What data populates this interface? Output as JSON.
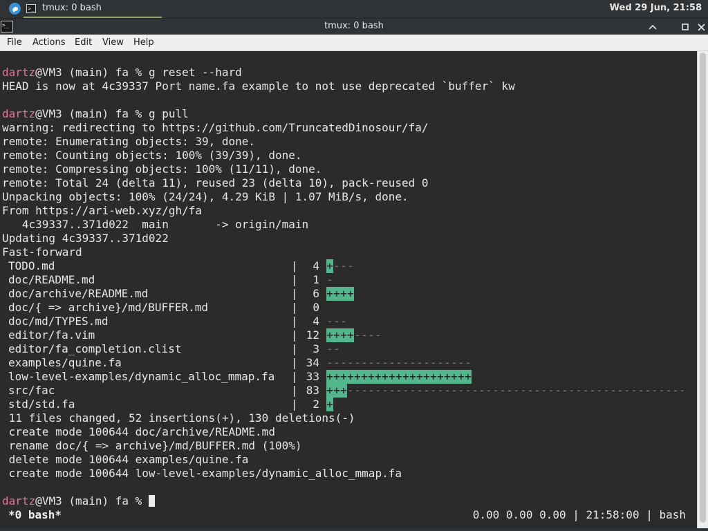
{
  "taskbar": {
    "logo_icon": "whisker-menu-icon",
    "task_label": "tmux: 0 bash",
    "clock": "Wed 29 Jun, 21:58"
  },
  "window": {
    "title": "tmux: 0 bash"
  },
  "menu": {
    "file": "File",
    "actions": "Actions",
    "edit": "Edit",
    "view": "View",
    "help": "Help"
  },
  "terminal": {
    "prompt_user": "dartz",
    "prompt_rest": "@VM3 (main) fa % ",
    "cmd1": "g reset --hard",
    "reset_out": "HEAD is now at 4c39337 Port name.fa example to not use deprecated `buffer` kw",
    "cmd2": "g pull",
    "pull_out": [
      "warning: redirecting to https://github.com/TruncatedDinosour/fa/",
      "remote: Enumerating objects: 39, done.",
      "remote: Counting objects: 100% (39/39), done.",
      "remote: Compressing objects: 100% (11/11), done.",
      "remote: Total 24 (delta 11), reused 23 (delta 10), pack-reused 0",
      "Unpacking objects: 100% (24/24), 4.29 KiB | 1.07 MiB/s, done.",
      "From https://ari-web.xyz/gh/fa",
      "   4c39337..371d022  main       -> origin/main",
      "Updating 4c39337..371d022",
      "Fast-forward"
    ],
    "diffstat": [
      {
        "file": "TODO.md",
        "count": "4",
        "plus": 1,
        "minus": 3
      },
      {
        "file": "doc/README.md",
        "count": "1",
        "plus": 0,
        "minus": 1
      },
      {
        "file": "doc/archive/README.md",
        "count": "6",
        "plus": 4,
        "minus": 0
      },
      {
        "file": "doc/{ => archive}/md/BUFFER.md",
        "count": "0",
        "plus": 0,
        "minus": 0
      },
      {
        "file": "doc/md/TYPES.md",
        "count": "4",
        "plus": 0,
        "minus": 3
      },
      {
        "file": "editor/fa.vim",
        "count": "12",
        "plus": 4,
        "minus": 4
      },
      {
        "file": "editor/fa_completion.clist",
        "count": "3",
        "plus": 0,
        "minus": 2
      },
      {
        "file": "examples/quine.fa",
        "count": "34",
        "plus": 0,
        "minus": 21
      },
      {
        "file": "low-level-examples/dynamic_alloc_mmap.fa",
        "count": "33",
        "plus": 21,
        "minus": 0
      },
      {
        "file": "src/fac",
        "count": "83",
        "plus": 3,
        "minus": 49
      },
      {
        "file": "std/std.fa",
        "count": "2",
        "plus": 1,
        "minus": 0
      }
    ],
    "summary": [
      " 11 files changed, 52 insertions(+), 130 deletions(-)",
      " create mode 100644 doc/archive/README.md",
      " rename doc/{ => archive}/md/BUFFER.md (100%)",
      " delete mode 100644 examples/quine.fa",
      " create mode 100644 low-level-examples/dynamic_alloc_mmap.fa"
    ]
  },
  "status": {
    "left": "*0 bash*",
    "right": "0.00 0.00 0.00 | 21:58:00 | bash"
  },
  "colors": {
    "prompt_user": "#e0739b",
    "insertion_bar": "#53b58b",
    "deletion_mark": "#7a7a7a",
    "terminal_bg": "#2b2b2b"
  }
}
